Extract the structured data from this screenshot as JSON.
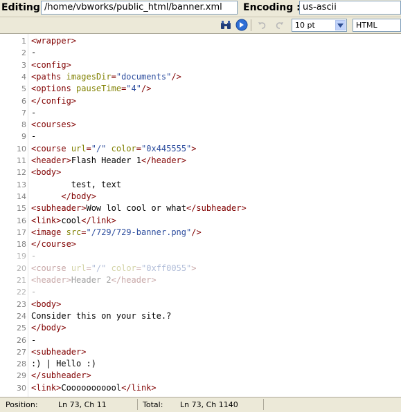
{
  "header": {
    "editing_label": "Editing:",
    "file_path": "/home/vbworks/public_html/banner.xml",
    "encoding_label": "Encoding :",
    "encoding_value": "us-ascii"
  },
  "toolbar": {
    "font_size": "10 pt",
    "syntax": "HTML",
    "icons": [
      "binoculars-icon",
      "go-icon",
      "undo-icon",
      "redo-icon"
    ]
  },
  "editor": {
    "lines": [
      {
        "n": "1",
        "text": "<wrapper>",
        "dim": false
      },
      {
        "n": "2",
        "text": "-",
        "dim": false
      },
      {
        "n": "3",
        "text": "<config>",
        "dim": false
      },
      {
        "n": "4",
        "text": "<paths imagesDir=\"documents\"/>",
        "dim": false
      },
      {
        "n": "5",
        "text": "<options pauseTime=\"4\"/>",
        "dim": false
      },
      {
        "n": "6",
        "text": "</config>",
        "dim": false
      },
      {
        "n": "7",
        "text": "-",
        "dim": false
      },
      {
        "n": "8",
        "text": "<courses>",
        "dim": false
      },
      {
        "n": "9",
        "text": "-",
        "dim": false
      },
      {
        "n": "10",
        "text": "<course url=\"/\" color=\"0x445555\">",
        "dim": false
      },
      {
        "n": "11",
        "text": "<header>Flash Header 1</header>",
        "dim": false
      },
      {
        "n": "12",
        "text": "<body>",
        "dim": false
      },
      {
        "n": "13",
        "text": "        test, text",
        "dim": false
      },
      {
        "n": "14",
        "text": "      </body>",
        "dim": false
      },
      {
        "n": "15",
        "text": "<subheader>Wow lol cool or what</subheader>",
        "dim": false
      },
      {
        "n": "16",
        "text": "<link>cool</link>",
        "dim": false
      },
      {
        "n": "17",
        "text": "<image src=\"/729/729-banner.png\"/>",
        "dim": false
      },
      {
        "n": "18",
        "text": "</course>",
        "dim": false
      },
      {
        "n": "19",
        "text": "-",
        "dim": true
      },
      {
        "n": "20",
        "text": "<course url=\"/\" color=\"0xff0055\">",
        "dim": true
      },
      {
        "n": "21",
        "text": "<header>Header 2</header>",
        "dim": true
      },
      {
        "n": "22",
        "text": "-",
        "dim": true
      },
      {
        "n": "23",
        "text": "<body>",
        "dim": false
      },
      {
        "n": "24",
        "text": "Consider this on your site.?",
        "dim": false
      },
      {
        "n": "25",
        "text": "</body>",
        "dim": false
      },
      {
        "n": "26",
        "text": "-",
        "dim": false
      },
      {
        "n": "27",
        "text": "<subheader>",
        "dim": false
      },
      {
        "n": "28",
        "text": ":) | Hello :)",
        "dim": false
      },
      {
        "n": "29",
        "text": "</subheader>",
        "dim": false
      },
      {
        "n": "30",
        "text": "<link>Cooooooooool</link>",
        "dim": false
      }
    ]
  },
  "statusbar": {
    "position_label": "Position:",
    "position_value": "Ln 73, Ch 11",
    "total_label": "Total:",
    "total_value": "Ln 73, Ch 1140"
  },
  "colors": {
    "tag": "#800000",
    "attr": "#808000",
    "value": "#2f4f9f",
    "text": "#000000",
    "chrome": "#ece9d8"
  }
}
